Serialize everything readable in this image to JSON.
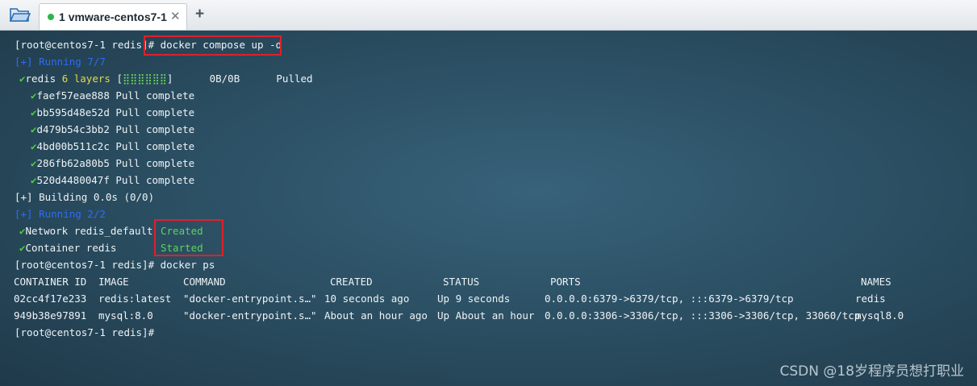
{
  "tab": {
    "number": "1",
    "title": "vmware-centos7-1",
    "close": "✕",
    "add": "+"
  },
  "terminal": {
    "prompt": "[root@centos7-1 redis]#",
    "cmd1": " docker compose up -d",
    "running1": "[+] Running 7/7",
    "redis_pull": {
      "name": "redis",
      "layers": "6 layers",
      "bar_open": "[",
      "bar_fill": "⣿⣿⣿⣿⣿⣿",
      "bar_close": "]",
      "size": "0B/0B",
      "status": "Pulled"
    },
    "layers": [
      {
        "id": "faef57eae888",
        "status": "Pull complete"
      },
      {
        "id": "bb595d48e52d",
        "status": "Pull complete"
      },
      {
        "id": "d479b54c3bb2",
        "status": "Pull complete"
      },
      {
        "id": "4bd00b511c2c",
        "status": "Pull complete"
      },
      {
        "id": "286fb62a80b5",
        "status": "Pull complete"
      },
      {
        "id": "520d4480047f",
        "status": "Pull complete"
      }
    ],
    "building": "[+] Building 0.0s (0/0)",
    "running2": "[+] Running 2/2",
    "network": {
      "label": "Network redis_default",
      "status": "Created"
    },
    "container": {
      "label": "Container redis",
      "status": "Started"
    },
    "cmd2": " docker ps",
    "ps_headers": [
      "CONTAINER ID",
      "IMAGE",
      "COMMAND",
      "CREATED",
      "STATUS",
      "PORTS",
      "NAMES"
    ],
    "ps_rows": [
      [
        "02cc4f17e233",
        "redis:latest",
        "\"docker-entrypoint.s…\"",
        "10 seconds ago",
        "Up 9 seconds",
        "0.0.0.0:6379->6379/tcp, :::6379->6379/tcp",
        "redis"
      ],
      [
        "949b38e97891",
        "mysql:8.0",
        "\"docker-entrypoint.s…\"",
        "About an hour ago",
        "Up About an hour",
        "0.0.0.0:3306->3306/tcp, :::3306->3306/tcp, 33060/tcp",
        "mysql8.0"
      ]
    ],
    "final_prompt": "[root@centos7-1 redis]#"
  },
  "watermark": "CSDN @18岁程序员想打职业",
  "colors": {
    "running": "#2f6cf0",
    "layers": "#e6d94a",
    "ok": "#5fd35f",
    "highlight": "#e0202a"
  }
}
